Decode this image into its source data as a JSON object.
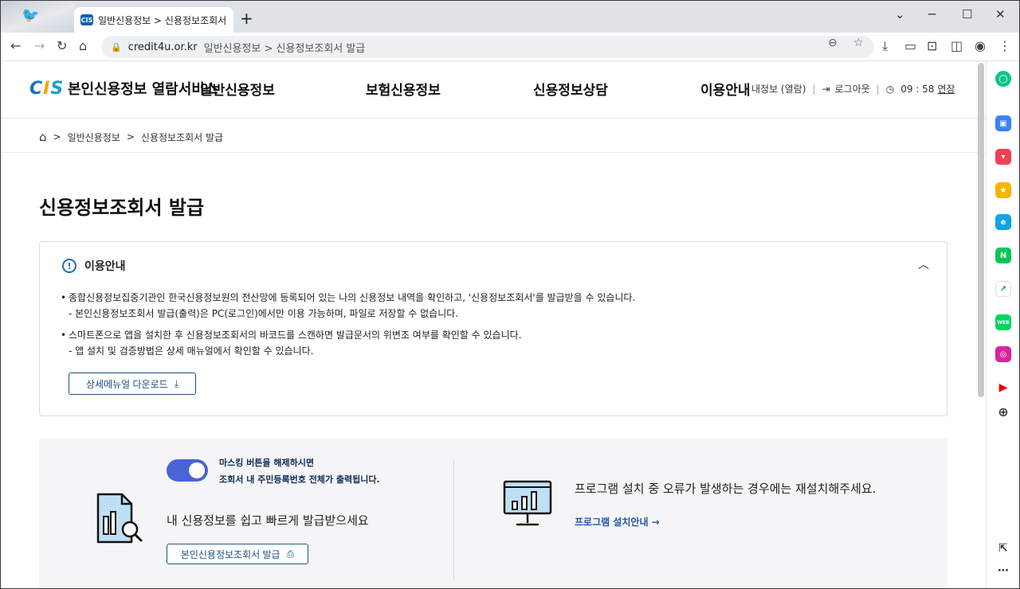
{
  "browser": {
    "tab_title": "일반신용정보 > 신용정보조회서",
    "favicon_text": "CIS",
    "url_host": "credit4u.or.kr",
    "url_path": "일반신용정보 > 신용정보조회서 발급"
  },
  "header": {
    "logo_text": "본인신용정보 열람서비스",
    "nav": [
      "일반신용정보",
      "보험신용정보",
      "신용정보상담",
      "이용안내"
    ],
    "util": {
      "info": "내정보 (열람)",
      "logout": "로그아웃",
      "time": "09 : 58",
      "extend": "연장"
    }
  },
  "breadcrumb": [
    "일반신용정보",
    "신용정보조회서 발급"
  ],
  "page_title": "신용정보조회서 발급",
  "notice": {
    "title": "이용안내",
    "items": [
      {
        "main": "종합신용정보집중기관인 한국신용정보원의 전산망에 등록되어 있는 나의 신용정보 내역을 확인하고, '신용정보조회서'를 발급받을 수 있습니다.",
        "sub": "- 본인신용정보조회서 발급(출력)은 PC(로그인)에서만 이용 가능하며, 파일로 저장할 수 없습니다."
      },
      {
        "main": "스마트폰으로 앱을 설치한 후 신용정보조회서의 바코드를 스캔하면 발급문서의 위변조 여부를 확인할 수 있습니다.",
        "sub": "- 앱 설치 및 검증방법은 상세 매뉴얼에서 확인할 수 있습니다."
      }
    ],
    "manual_button": "상세메뉴얼 다운로드"
  },
  "issue": {
    "mask_line1": "마스킹 버튼을 해제하시면",
    "mask_line2": "조회서 내 주민등록번호 전체가 출력됩니다.",
    "subtitle": "내 신용정보를 쉽고 빠르게 발급받으세요",
    "button": "본인신용정보조회서 발급",
    "masking_toggle_on": true
  },
  "install": {
    "message": "프로그램 설치 중 오류가 발생하는 경우에는 재설치해주세요.",
    "link": "프로그램 설치안내 →"
  },
  "colors": {
    "accent": "#1a4f86",
    "toggle": "#4a63d6",
    "link": "#1e57a6"
  }
}
